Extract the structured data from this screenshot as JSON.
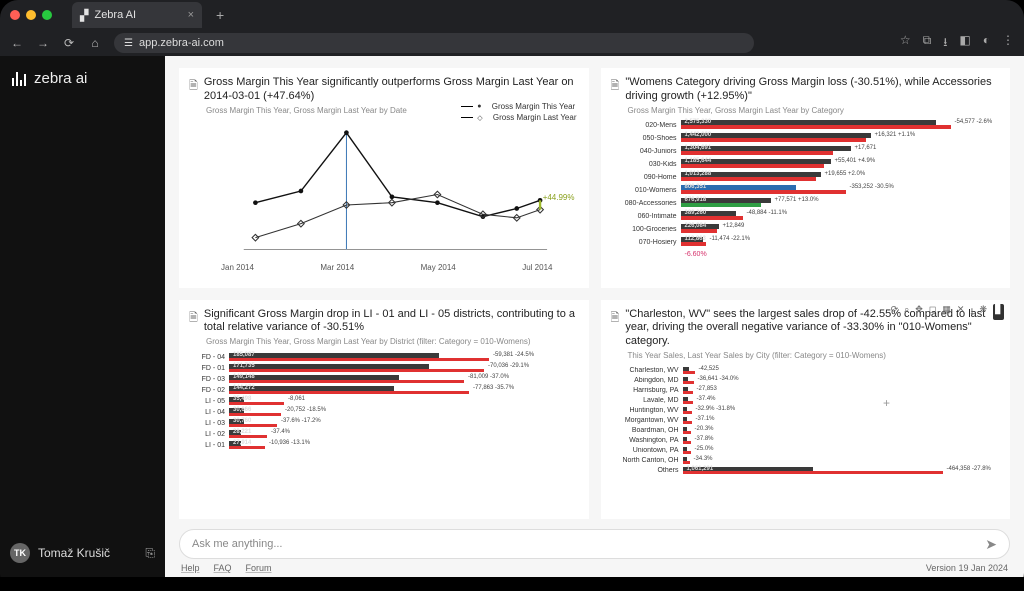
{
  "browser": {
    "tab_title": "Zebra AI",
    "url": "app.zebra-ai.com"
  },
  "brand": {
    "name": "zebra ai"
  },
  "user": {
    "initials": "TK",
    "name": "Tomaž Krušič"
  },
  "ask": {
    "placeholder": "Ask me anything..."
  },
  "footer": {
    "help": "Help",
    "faq": "FAQ",
    "forum": "Forum",
    "version": "Version 19 Jan 2024"
  },
  "card1": {
    "title": "Gross Margin This Year significantly outperforms Gross Margin Last Year on 2014-03-01 (+47.64%)",
    "sub": "Gross Margin This Year, Gross Margin Last Year by Date",
    "legend_a": "Gross Margin This Year",
    "legend_b": "Gross Margin Last Year",
    "annot": "+44.99%",
    "x_ticks": [
      "Jan 2014",
      "Mar 2014",
      "May 2014",
      "Jul 2014"
    ]
  },
  "card2": {
    "title": "\"Womens Category driving Gross Margin loss (-30.51%), while Accessories driving growth (+12.95%)\"",
    "sub": "Gross Margin This Year, Gross Margin Last Year by Category",
    "rows": [
      {
        "cat": "020-Mens",
        "a": 255,
        "b": 270,
        "val": "2,575,330",
        "tail": "-54,577  -2.6%"
      },
      {
        "cat": "050-Shoes",
        "a": 190,
        "b": 185,
        "val": "1,442,000",
        "tail": "+16,321  +1.1%"
      },
      {
        "cat": "040-Juniors",
        "a": 170,
        "b": 152,
        "val": "1,304,691",
        "tail": "+17,671"
      },
      {
        "cat": "030-Kids",
        "a": 150,
        "b": 143,
        "val": "1,185,644",
        "tail": "+55,401  +4.9%"
      },
      {
        "cat": "090-Home",
        "a": 140,
        "b": 135,
        "val": "1,013,288",
        "tail": "+19,655  +2.0%"
      },
      {
        "cat": "010-Womens",
        "a": 115,
        "b": 165,
        "val": "806,351",
        "tail": "-353,252  -30.5%",
        "hl": "blue"
      },
      {
        "cat": "080-Accessories",
        "a": 90,
        "b": 80,
        "val": "676,918",
        "tail": "+77,571  +13.0%",
        "hlg": "green"
      },
      {
        "cat": "060-Intimate",
        "a": 55,
        "b": 62,
        "val": "389,260",
        "tail": "-48,884  -11.1%"
      },
      {
        "cat": "100-Groceries",
        "a": 38,
        "b": 36,
        "val": "226,084",
        "tail": "+12,849"
      },
      {
        "cat": "070-Hosiery",
        "a": 22,
        "b": 25,
        "val": "112,863",
        "tail": "-11,474  -22.1%"
      }
    ],
    "foot": "-6.60%"
  },
  "card3": {
    "title": "Significant Gross Margin drop in LI - 01 and LI - 05 districts, contributing to a total relative variance of -30.51%",
    "sub": "Gross Margin This Year, Gross Margin Last Year by District (filter: Category = 010-Womens)",
    "rows": [
      {
        "cat": "FD - 04",
        "a": 210,
        "b": 260,
        "val": "185,087",
        "tail": "-59,381  -24.5%"
      },
      {
        "cat": "FD - 01",
        "a": 200,
        "b": 255,
        "val": "171,735",
        "tail": "-70,036  -29.1%"
      },
      {
        "cat": "FD - 03",
        "a": 170,
        "b": 235,
        "val": "149,148",
        "tail": "-81,009  -37.0%"
      },
      {
        "cat": "FD - 02",
        "a": 165,
        "b": 240,
        "val": "144,272",
        "tail": "-77,863  -35.7%"
      },
      {
        "cat": "LI - 05",
        "a": 15,
        "b": 55,
        "val": "35,498",
        "tail": "-8,061"
      },
      {
        "cat": "LI - 04",
        "a": 15,
        "b": 52,
        "val": "30,666",
        "tail": "-20,752  -18.5%"
      },
      {
        "cat": "LI - 03",
        "a": 15,
        "b": 48,
        "val": "30,760",
        "tail": "-37.6%  -17.2%"
      },
      {
        "cat": "LI - 02",
        "a": 12,
        "b": 38,
        "val": "28,221",
        "tail": "-37.4%"
      },
      {
        "cat": "LI - 01",
        "a": 12,
        "b": 36,
        "val": "27,914",
        "tail": "-10,936  -13.1%"
      }
    ]
  },
  "card4": {
    "title": "\"Charleston, WV\" sees the largest sales drop of -42.55% compared to last year, driving the overall negative variance of -33.30% in \"010-Womens\" category.",
    "sub": "This Year Sales, Last Year Sales by City (filter: Category = 010-Womens)",
    "rows": [
      {
        "cat": "Charleston, WV",
        "a": 6,
        "b": 12,
        "tail": "-42,525"
      },
      {
        "cat": "Abingdon, MD",
        "a": 5,
        "b": 11,
        "tail": "-36,641  -34.0%"
      },
      {
        "cat": "Harrisburg, PA",
        "a": 5,
        "b": 10,
        "tail": "-27,853"
      },
      {
        "cat": "Lavale, MD",
        "a": 5,
        "b": 10,
        "tail": "-37.4%"
      },
      {
        "cat": "Huntington, WV",
        "a": 4,
        "b": 9,
        "tail": "-32.9%  -31.8%"
      },
      {
        "cat": "Morgantown, WV",
        "a": 4,
        "b": 9,
        "tail": "-37.1%"
      },
      {
        "cat": "Boardman, OH",
        "a": 4,
        "b": 8,
        "tail": "-20.3%"
      },
      {
        "cat": "Washington, PA",
        "a": 4,
        "b": 8,
        "tail": "-37.8%"
      },
      {
        "cat": "Uniontown, PA",
        "a": 4,
        "b": 8,
        "tail": "-25.0%"
      },
      {
        "cat": "North Canton, OH",
        "a": 4,
        "b": 7,
        "tail": "-34.3%"
      },
      {
        "cat": "Others",
        "a": 130,
        "b": 260,
        "val": "1,061,291",
        "tail": "-464,358  -27.8%"
      }
    ]
  },
  "chart_data": {
    "type": "line",
    "title": "Gross Margin This Year vs Gross Margin Last Year by Date",
    "xlabel": "",
    "ylabel": "",
    "x": [
      "2014-01",
      "2014-02",
      "2014-03",
      "2014-04",
      "2014-05",
      "2014-06",
      "2014-07",
      "2014-08"
    ],
    "series": [
      {
        "name": "Gross Margin This Year",
        "values": [
          0.55,
          0.6,
          1.0,
          0.58,
          0.55,
          0.46,
          0.5,
          0.55
        ]
      },
      {
        "name": "Gross Margin Last Year",
        "values": [
          0.3,
          0.4,
          0.55,
          0.55,
          0.6,
          0.48,
          0.45,
          0.52
        ]
      }
    ],
    "annotations": [
      {
        "x": "2014-03",
        "text": "+47.64%"
      },
      {
        "x": "2014-08",
        "text": "+44.99%"
      }
    ]
  }
}
